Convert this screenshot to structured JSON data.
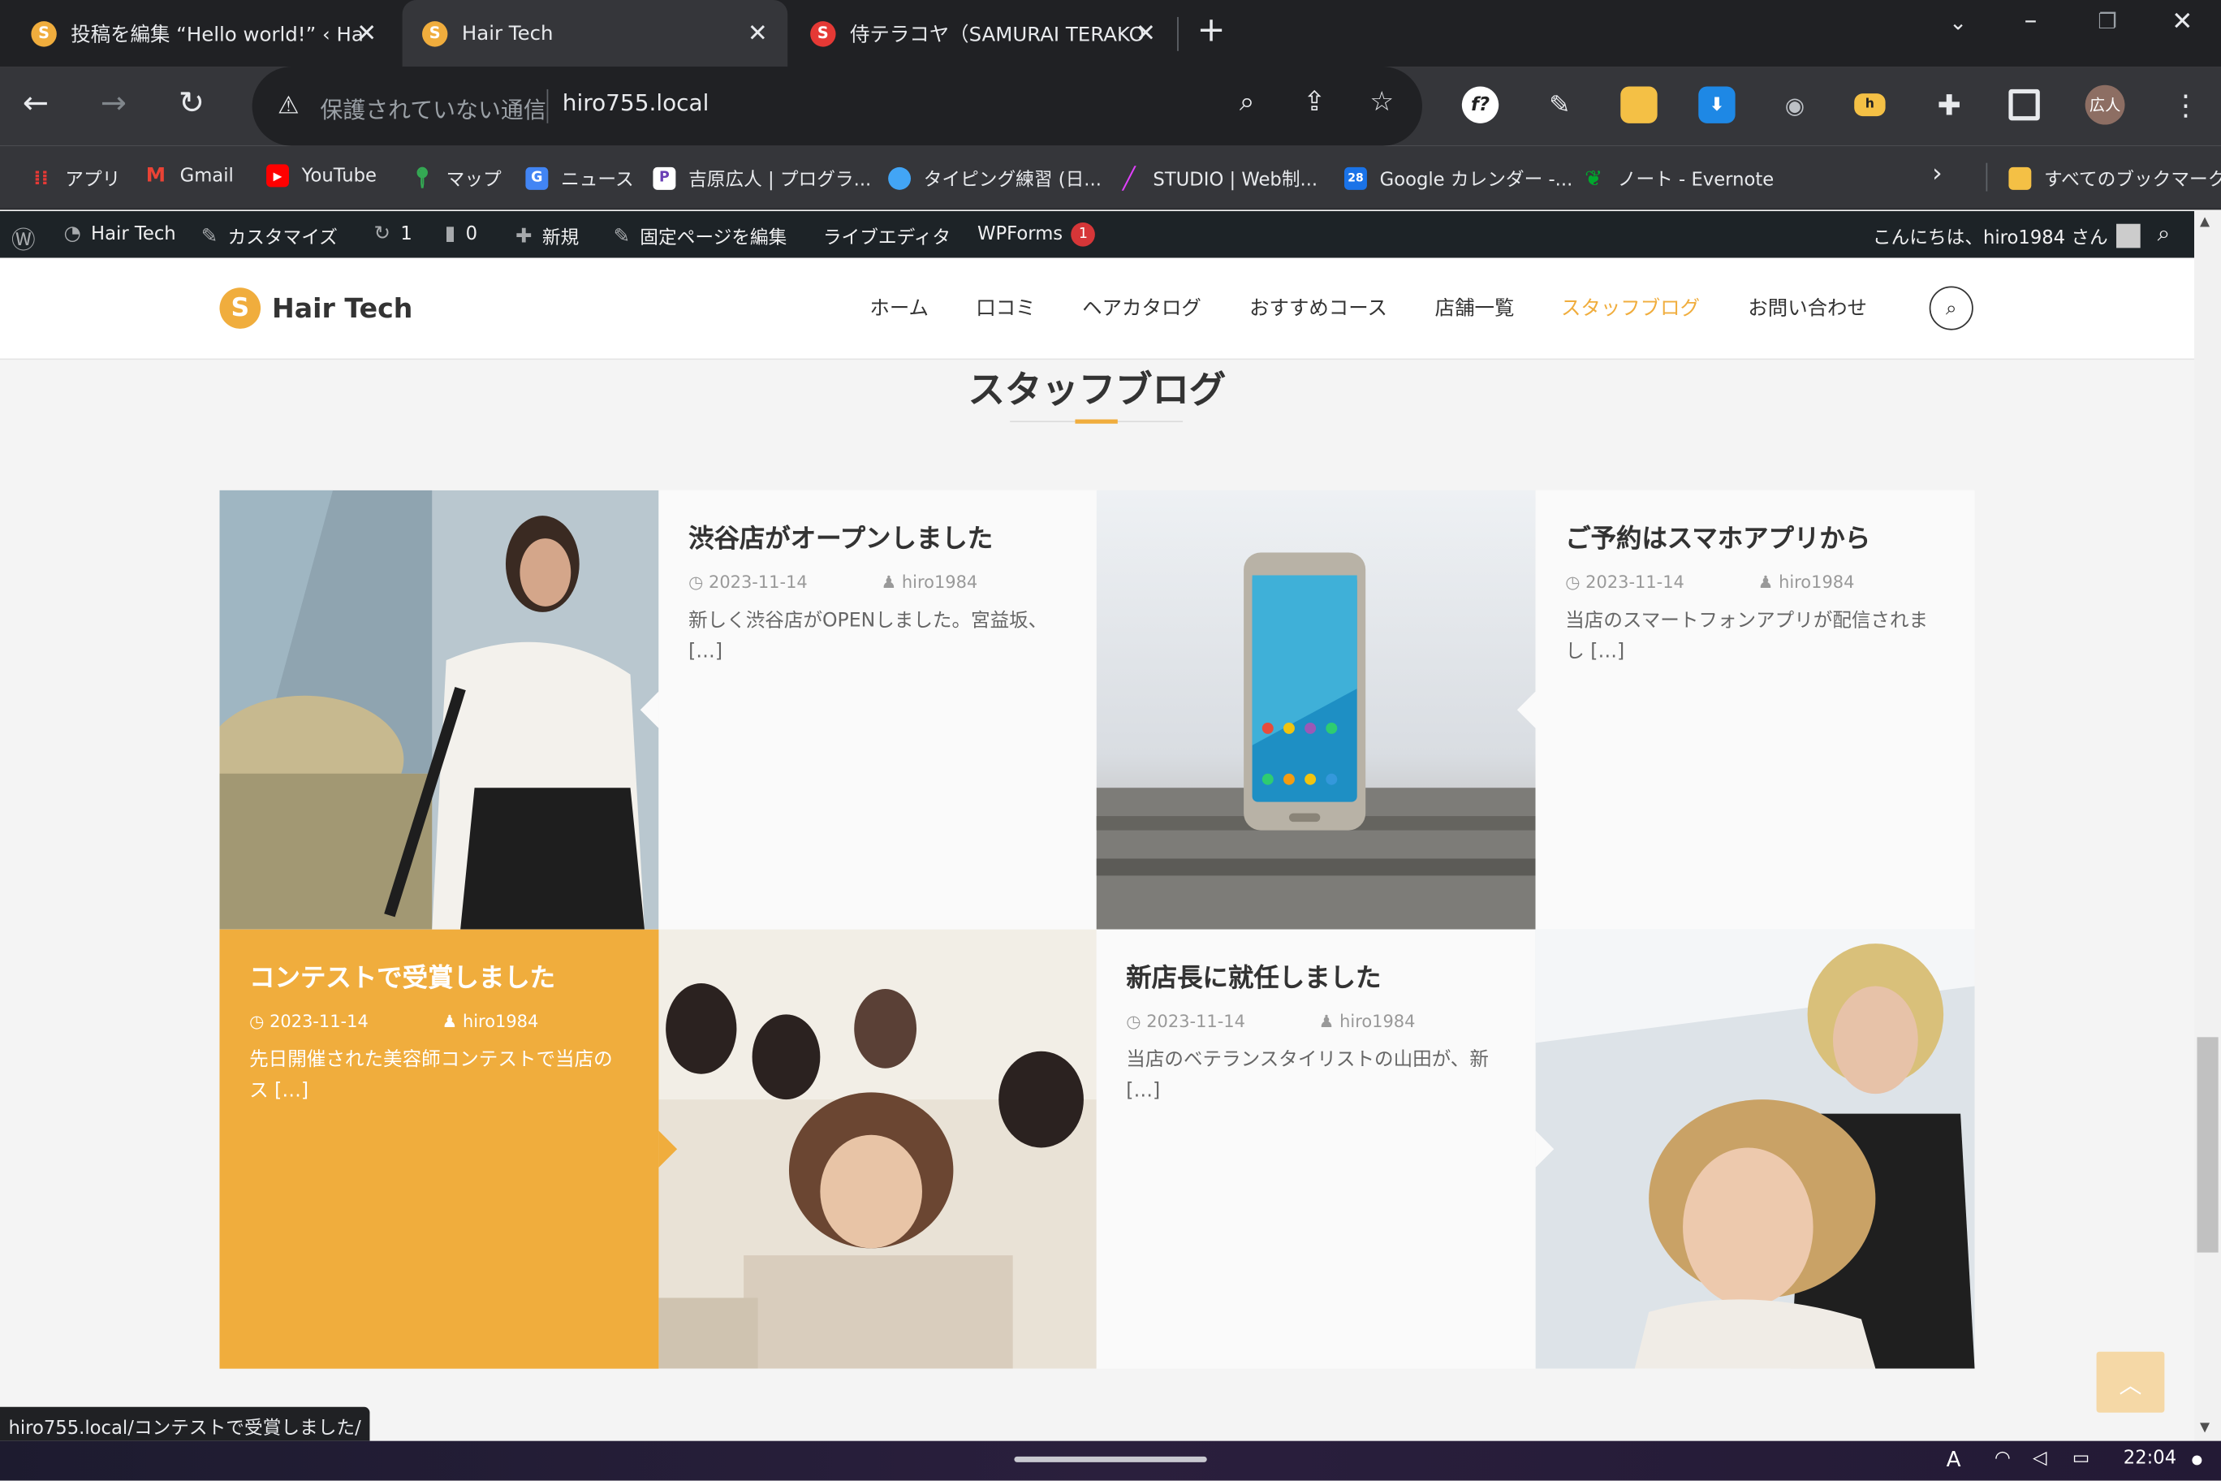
{
  "browser": {
    "tabs": [
      {
        "title": "投稿を編集 “Hello world!” ‹ Ha",
        "active": false
      },
      {
        "title": "Hair Tech",
        "active": true
      },
      {
        "title": "侍テラコヤ（SAMURAI TERAKO",
        "active": false
      }
    ],
    "new_tab_label": "+",
    "omnibox": {
      "security_text": "保護されていない通信",
      "url": "hiro755.local"
    },
    "profile_label": "広人",
    "bookmarks": [
      {
        "label": "アプリ",
        "icon": "apps-grid-icon",
        "color": "#e53935"
      },
      {
        "label": "Gmail",
        "icon": "gmail-icon",
        "color": "#ea4335"
      },
      {
        "label": "YouTube",
        "icon": "youtube-icon",
        "color": "#ff0000"
      },
      {
        "label": "マップ",
        "icon": "maps-pin-icon",
        "color": "#34a853"
      },
      {
        "label": "ニュース",
        "icon": "news-icon",
        "color": "#4285f4"
      },
      {
        "label": "吉原広人 | プログラ...",
        "icon": "p-icon",
        "color": "#6a3fb5"
      },
      {
        "label": "タイピング練習 (日...",
        "icon": "typing-icon",
        "color": "#42a5f5"
      },
      {
        "label": "STUDIO | Web制...",
        "icon": "studio-icon",
        "color": "#e040fb"
      },
      {
        "label": "Google カレンダー -...",
        "icon": "calendar-icon",
        "color": "#1a73e8"
      },
      {
        "label": "ノート - Evernote",
        "icon": "evernote-icon",
        "color": "#00a82d"
      }
    ],
    "all_bookmarks_label": "すべてのブックマーク"
  },
  "wp_admin": {
    "site_name": "Hair Tech",
    "customize": "カスタマイズ",
    "updates_count": "1",
    "comments_count": "0",
    "new_label": "新規",
    "edit_page": "固定ページを編集",
    "live_editor": "ライブエディタ",
    "wpforms": "WPForms",
    "wpforms_badge": "1",
    "greeting": "こんにちは、hiro1984 さん"
  },
  "site": {
    "logo_text": "Hair Tech",
    "nav": [
      "ホーム",
      "口コミ",
      "ヘアカタログ",
      "おすすめコース",
      "店舗一覧",
      "スタッフブログ",
      "お問い合わせ"
    ],
    "nav_current_index": 5,
    "accent_color": "#f0ad3d"
  },
  "page": {
    "title": "スタッフブログ",
    "posts": [
      {
        "title": "渋谷店がオープンしました",
        "date": "2023-11-14",
        "author": "hiro1984",
        "excerpt": "新しく渋谷店がOPENしました。宮益坂、[…]"
      },
      {
        "title": "ご予約はスマホアプリから",
        "date": "2023-11-14",
        "author": "hiro1984",
        "excerpt": "当店のスマートフォンアプリが配信されまし […]"
      },
      {
        "title": "コンテストで受賞しました",
        "date": "2023-11-14",
        "author": "hiro1984",
        "excerpt": "先日開催された美容師コンテストで当店のス […]"
      },
      {
        "title": "新店長に就任しました",
        "date": "2023-11-14",
        "author": "hiro1984",
        "excerpt": "当店のベテランスタイリストの山田が、新 […]"
      }
    ]
  },
  "status_url": "hiro755.local/コンテストで受賞しました/",
  "clock": "22:04"
}
